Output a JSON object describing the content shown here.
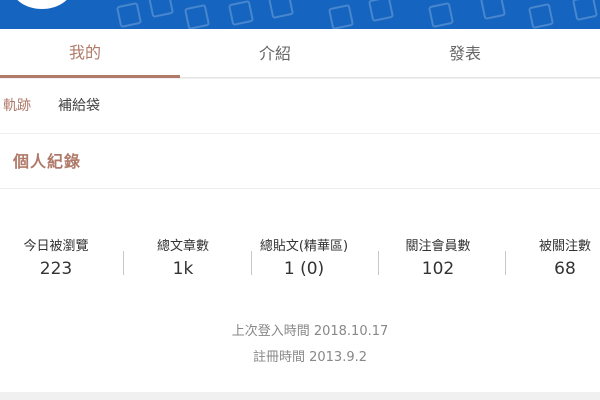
{
  "tabs": [
    {
      "label": "我的"
    },
    {
      "label": "介紹"
    },
    {
      "label": "發表"
    }
  ],
  "subtabs": [
    {
      "label": "軌跡"
    },
    {
      "label": "補給袋"
    }
  ],
  "record": {
    "title": "個人紀錄",
    "stats": [
      {
        "label": "今日被瀏覽",
        "value": "223"
      },
      {
        "label": "總文章數",
        "value": "1k"
      },
      {
        "label": "總貼文(精華區)",
        "value": "1 (0)"
      },
      {
        "label": "關注會員數",
        "value": "102"
      },
      {
        "label": "被關注數",
        "value": "68"
      }
    ],
    "last_login": "上次登入時間 2018.10.17",
    "registered": "註冊時間 2013.9.2"
  },
  "colors": {
    "accent": "#b07a6a",
    "banner": "#1565c0"
  }
}
